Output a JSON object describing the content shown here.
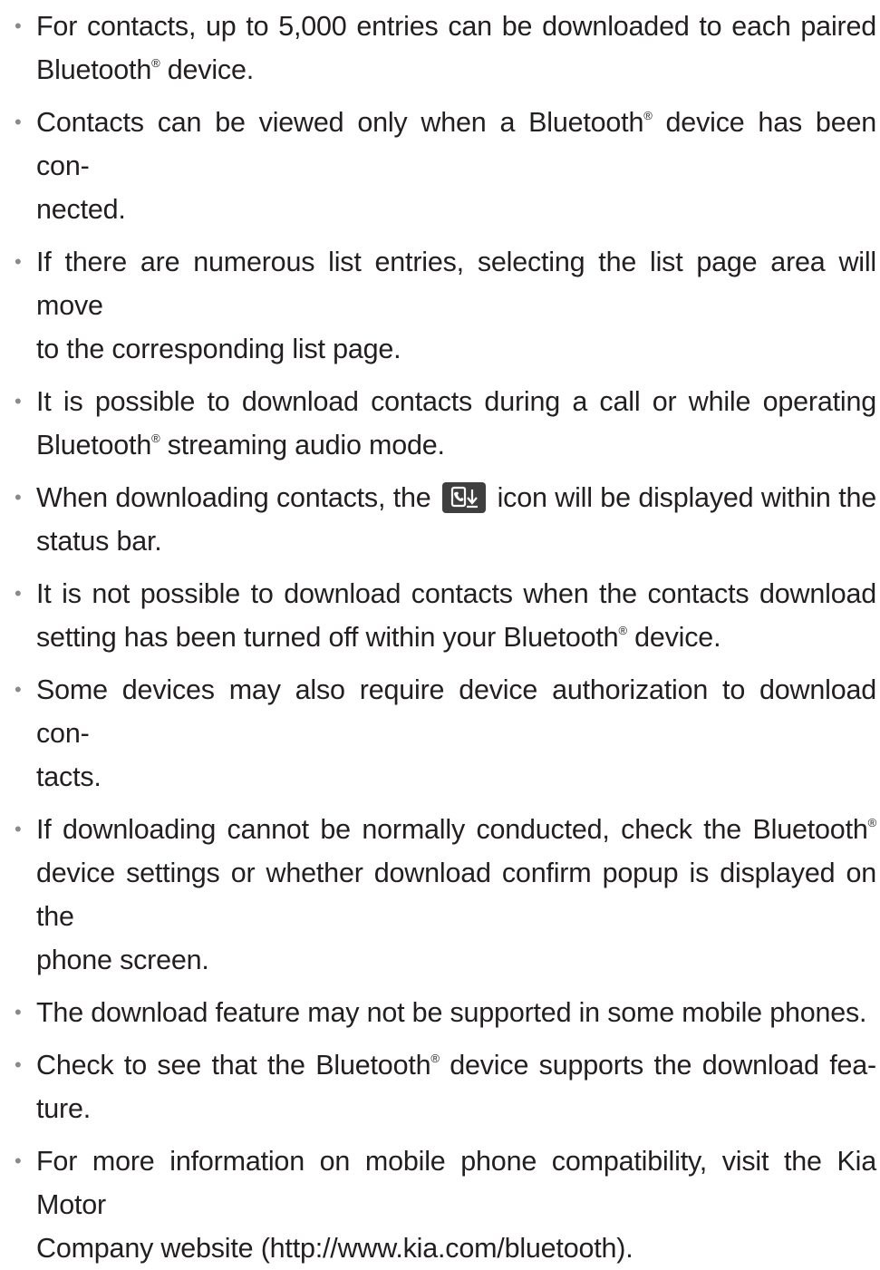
{
  "notes": [
    {
      "lines": [
        "For contacts, up to 5,000 entries can be downloaded to each paired",
        "Bluetooth",
        "®",
        " device."
      ]
    },
    {
      "line1": [
        "Contacts can be viewed only when a Bluetooth",
        "®",
        " device has been con-"
      ],
      "line2": "nected."
    },
    {
      "line1": "If there are numerous list entries, selecting the list page area will move",
      "line2": "to the corresponding list page."
    },
    {
      "line1": "It is possible to download contacts during a call or while operating",
      "line2": [
        "Bluetooth",
        "®",
        " streaming audio mode."
      ]
    },
    {
      "line1_a": "When downloading contacts, the",
      "icon": "contacts-download-icon",
      "line1_b": "icon will be displayed within the",
      "line2": "status bar."
    },
    {
      "line1": "It is not possible to download contacts when the contacts download",
      "line2": [
        "setting has been turned off within your Bluetooth",
        "®",
        " device."
      ]
    },
    {
      "line1": "Some devices may also require device authorization to download con-",
      "line2": "tacts."
    },
    {
      "line1": [
        "If downloading cannot be normally conducted, check the Bluetooth",
        "®"
      ],
      "line2": "device settings or whether download confirm popup is displayed on the",
      "line3": "phone screen."
    },
    {
      "line1": "The download feature may not be supported in some mobile phones."
    },
    {
      "line1": [
        "Check to see that the Bluetooth",
        "®",
        " device supports the download fea-"
      ],
      "line2": "ture."
    },
    {
      "line1": "For more information on mobile phone compatibility, visit the Kia Motor",
      "line2": "Company website (http://www.kia.com/bluetooth)."
    }
  ],
  "bullet": "•",
  "colors": {
    "text": "#231f20",
    "bullet": "#8a8a8a",
    "icon_bg": "#3f3f3f",
    "icon_fg": "#ffffff"
  }
}
